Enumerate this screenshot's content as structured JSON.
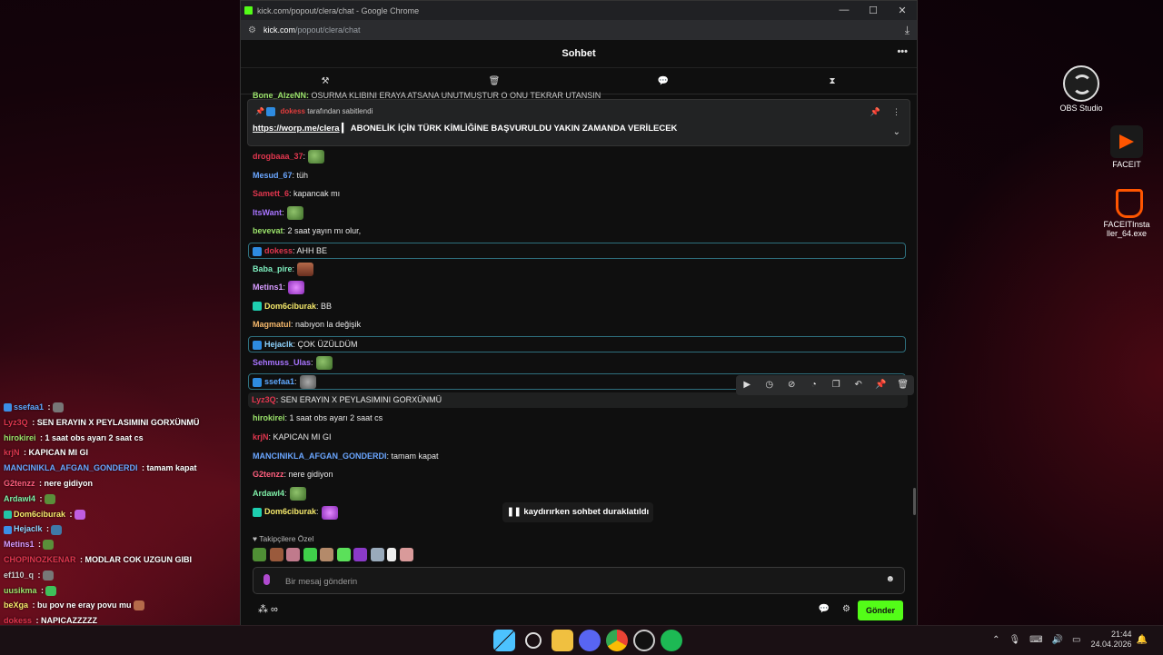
{
  "desktop": {
    "icons": [
      {
        "label": "OBS Studio"
      },
      {
        "label": "FACEIT"
      },
      {
        "label": "FACEITInstaller_64.exe"
      }
    ]
  },
  "overlay": {
    "lines": [
      {
        "user": "ssefaa1",
        "sep": " :",
        "text": "",
        "color": "#5fa8ff",
        "badge": "sub",
        "emote": "#777"
      },
      {
        "user": "Lyz3Q",
        "sep": " :",
        "text": " SEN ERAYIN X PEYLASIMINI GORXÜNMÜ",
        "color": "#e0364e"
      },
      {
        "user": "hirokirei",
        "sep": " :",
        "text": " 1 saat obs ayarı 2 saat cs",
        "color": "#9be36b"
      },
      {
        "user": "krjN",
        "sep": " :",
        "text": " KAPICAN MI GI",
        "color": "#e0364e"
      },
      {
        "user": "MANCINIKLA_AFGAN_GONDERDI",
        "sep": " :",
        "text": " tamam kapat",
        "color": "#6aa6ff"
      },
      {
        "user": "G2tenzz",
        "sep": " :",
        "text": " nere gidiyon",
        "color": "#ff5f7e"
      },
      {
        "user": "Ardawl4",
        "sep": " :",
        "text": "",
        "color": "#7ff0a8",
        "emote": "#5a8f3a"
      },
      {
        "user": "Dom6ciburak",
        "sep": " :",
        "text": "",
        "color": "#f5e96b",
        "badge": "gift",
        "emote": "#c05de0"
      },
      {
        "user": "Hejaclk",
        "sep": " :",
        "text": "",
        "color": "#8fd4ff",
        "badge": "sub",
        "emote": "#3f7aa8"
      },
      {
        "user": "Metins1",
        "sep": " :",
        "text": "",
        "color": "#d79bff",
        "emote": "#5a8f3a"
      },
      {
        "user": "CHOPINOZKENAR",
        "sep": " :",
        "text": " MODLAR COK UZGUN GIBI",
        "color": "#e0364e"
      },
      {
        "user": "ef110_q",
        "sep": " :",
        "text": "",
        "color": "#d0d0d0",
        "emote": "#777"
      },
      {
        "user": "uusikma",
        "sep": " :",
        "text": "",
        "color": "#9be36b",
        "emote": "#3fbf5a"
      },
      {
        "user": "beXga",
        "sep": " :",
        "text": " bu pov ne eray povu mu",
        "color": "#f5e96b",
        "emote": "#b56a4a"
      },
      {
        "user": "dokess",
        "sep": " :",
        "text": " NAPICAZZZZZ",
        "color": "#e0364e"
      }
    ]
  },
  "browser": {
    "title": "kick.com/popout/clera/chat - Google Chrome",
    "url_host": "kick.com",
    "url_path": "/popout/clera/chat"
  },
  "chat": {
    "header": "Sohbet",
    "top_partial": {
      "user": "Bone_AlzeNN:",
      "text": " OSURMA KLIBINI ERAYA ATSANA UNUTMUŞTUR O ONU TEKRAR UTANSIN "
    },
    "pinned": {
      "by_user": "dokess",
      "by_suffix": " tarafından sabitlendi",
      "link": "https://worp.me/clera",
      "text": " ▎ ABONELİK İÇİN TÜRK KİMLİĞİNE BAŞVURULDU YAKIN ZAMANDA VERİLECEK"
    },
    "messages": [
      {
        "user": "drogbaaa_37",
        "sep": ":",
        "text": "",
        "color": "#e0364e",
        "emote": "frog"
      },
      {
        "user": "Mesud_67",
        "sep": ":",
        "text": " tüh",
        "color": "#6aa6ff"
      },
      {
        "user": "Samett_6",
        "sep": ":",
        "text": " kapancak mı",
        "color": "#e0364e"
      },
      {
        "user": "ItsWant",
        "sep": ":",
        "text": "",
        "color": "#a874ff",
        "emote": "frog"
      },
      {
        "user": "bevevat",
        "sep": ":",
        "text": " 2 saat yayın mı olur,",
        "color": "#9be36b"
      },
      {
        "user": "dokess",
        "sep": ":",
        "text": " AHH BE",
        "color": "#e0364e",
        "badge": "sub",
        "hl": true
      },
      {
        "user": "Baba_pire",
        "sep": ":",
        "text": "",
        "color": "#7ff0c0",
        "emote": "face"
      },
      {
        "user": "Metins1",
        "sep": ":",
        "text": "",
        "color": "#d79bff",
        "emote": "pink"
      },
      {
        "user": "Dom6ciburak",
        "sep": ":",
        "text": " BB",
        "color": "#f5e96b",
        "badge": "gift"
      },
      {
        "user": "Magmatul",
        "sep": ":",
        "text": " nabıyon la değişik",
        "color": "#f5b86b"
      },
      {
        "user": "Hejaclk",
        "sep": ":",
        "text": " ÇOK ÜZÜLDÜM",
        "color": "#8fd4ff",
        "badge": "sub",
        "hl": true
      },
      {
        "user": "Sehmuss_Ulas",
        "sep": ":",
        "text": "",
        "color": "#a874ff",
        "emote": "frog"
      },
      {
        "user": "ssefaa1",
        "sep": ":",
        "text": "",
        "color": "#5fa8ff",
        "badge": "sub",
        "hl": true,
        "emote": "rock"
      },
      {
        "user": "Lyz3Q",
        "sep": ":",
        "text": " SEN ERAYIN X PEYLASIMINI GORXÜNMÜ",
        "color": "#e0364e",
        "hover": true
      },
      {
        "user": "hirokirei",
        "sep": ":",
        "text": " 1 saat obs ayarı 2 saat cs",
        "color": "#9be36b"
      },
      {
        "user": "krjN",
        "sep": ":",
        "text": " KAPICAN MI GI",
        "color": "#e0364e"
      },
      {
        "user": "MANCINIKLA_AFGAN_GONDERDI",
        "sep": ":",
        "text": " tamam kapat",
        "color": "#6aa6ff"
      },
      {
        "user": "G2tenzz",
        "sep": ":",
        "text": " nere gidiyon",
        "color": "#ff5f7e"
      },
      {
        "user": "Ardawl4",
        "sep": ":",
        "text": "",
        "color": "#7ff0a8",
        "emote": "frog"
      },
      {
        "user": "Dom6ciburak",
        "sep": ":",
        "text": "",
        "color": "#f5e96b",
        "badge": "gift",
        "emote": "pink"
      }
    ],
    "paused_label": "kaydırırken sohbet duraklatıldı",
    "followers_label": "Takipçilere Özel",
    "input_placeholder": "Bir mesaj gönderin",
    "send_label": "Gönder",
    "accent": "#53fc18"
  },
  "taskbar": {
    "time": "21:44",
    "date": "24.04.2026"
  }
}
